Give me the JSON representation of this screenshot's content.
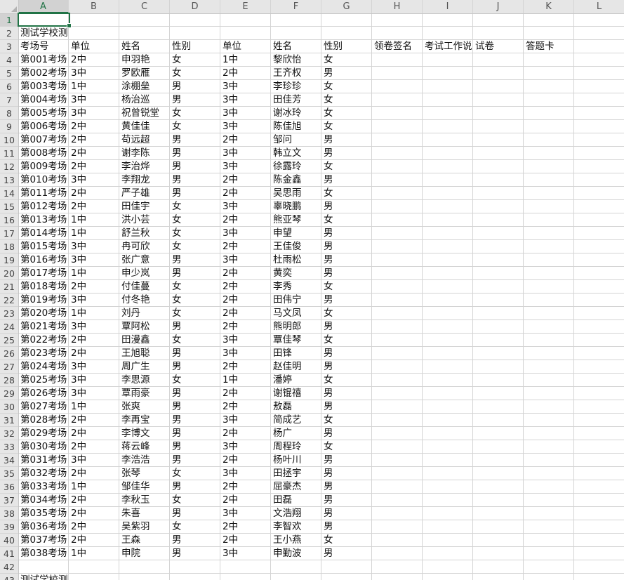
{
  "columns": [
    "A",
    "B",
    "C",
    "D",
    "E",
    "F",
    "G",
    "H",
    "I",
    "J",
    "K",
    "L"
  ],
  "active_cell": "A1",
  "colors": {
    "accent": "#217346",
    "grid": "#d4d4d4",
    "header_bg": "#e6e6e6"
  },
  "row2_title": "测试学校测",
  "header_row": {
    "A": "考场号",
    "B": "单位",
    "C": "姓名",
    "D": "性别",
    "E": "单位",
    "F": "姓名",
    "G": "性别",
    "H": "领卷签名",
    "I": "考试工作说",
    "J": "试卷",
    "K": "答题卡"
  },
  "rows": [
    [
      "第001考场",
      "2中",
      "申羽艳",
      "女",
      "1中",
      "黎欣怡",
      "女"
    ],
    [
      "第002考场",
      "3中",
      "罗欧雁",
      "女",
      "2中",
      "王齐权",
      "男"
    ],
    [
      "第003考场",
      "1中",
      "涂棚垒",
      "男",
      "3中",
      "李珍珍",
      "女"
    ],
    [
      "第004考场",
      "3中",
      "杨治巡",
      "男",
      "3中",
      "田佳芳",
      "女"
    ],
    [
      "第005考场",
      "3中",
      "祝曾锐堂",
      "女",
      "3中",
      "谢冰玲",
      "女"
    ],
    [
      "第006考场",
      "2中",
      "黄佳佳",
      "女",
      "3中",
      "陈佳旭",
      "女"
    ],
    [
      "第007考场",
      "2中",
      "苟远超",
      "男",
      "2中",
      "邹问",
      "男"
    ],
    [
      "第008考场",
      "2中",
      "谢李陈",
      "男",
      "3中",
      "韩立文",
      "男"
    ],
    [
      "第009考场",
      "2中",
      "李治烨",
      "男",
      "3中",
      "徐露玲",
      "女"
    ],
    [
      "第010考场",
      "3中",
      "李翔龙",
      "男",
      "2中",
      "陈金鑫",
      "男"
    ],
    [
      "第011考场",
      "2中",
      "严子雄",
      "男",
      "2中",
      "吴思雨",
      "女"
    ],
    [
      "第012考场",
      "2中",
      "田佳宇",
      "女",
      "3中",
      "辜晓鹏",
      "男"
    ],
    [
      "第013考场",
      "1中",
      "洪小芸",
      "女",
      "2中",
      "熊亚琴",
      "女"
    ],
    [
      "第014考场",
      "1中",
      "舒兰秋",
      "女",
      "3中",
      "申望",
      "男"
    ],
    [
      "第015考场",
      "3中",
      "冉可欣",
      "女",
      "2中",
      "王佳俊",
      "男"
    ],
    [
      "第016考场",
      "3中",
      "张广意",
      "男",
      "3中",
      "杜雨松",
      "男"
    ],
    [
      "第017考场",
      "1中",
      "申少岚",
      "男",
      "2中",
      "黄奕",
      "男"
    ],
    [
      "第018考场",
      "2中",
      "付佳蔓",
      "女",
      "2中",
      "李秀",
      "女"
    ],
    [
      "第019考场",
      "3中",
      "付冬艳",
      "女",
      "2中",
      "田伟宁",
      "男"
    ],
    [
      "第020考场",
      "1中",
      "刘丹",
      "女",
      "2中",
      "马文凤",
      "女"
    ],
    [
      "第021考场",
      "3中",
      "覃阿松",
      "男",
      "2中",
      "熊明郎",
      "男"
    ],
    [
      "第022考场",
      "2中",
      "田漫鑫",
      "女",
      "3中",
      "覃佳琴",
      "女"
    ],
    [
      "第023考场",
      "2中",
      "王旭聪",
      "男",
      "3中",
      "田锋",
      "男"
    ],
    [
      "第024考场",
      "3中",
      "周广生",
      "男",
      "2中",
      "赵佳明",
      "男"
    ],
    [
      "第025考场",
      "3中",
      "李思源",
      "女",
      "1中",
      "潘婷",
      "女"
    ],
    [
      "第026考场",
      "3中",
      "覃雨豪",
      "男",
      "2中",
      "谢锟禧",
      "男"
    ],
    [
      "第027考场",
      "1中",
      "张爽",
      "男",
      "2中",
      "敖磊",
      "男"
    ],
    [
      "第028考场",
      "2中",
      "李再宝",
      "男",
      "3中",
      "简成艺",
      "女"
    ],
    [
      "第029考场",
      "2中",
      "李博文",
      "男",
      "2中",
      "杨广",
      "男"
    ],
    [
      "第030考场",
      "2中",
      "蒋云峰",
      "男",
      "3中",
      "周程玲",
      "女"
    ],
    [
      "第031考场",
      "3中",
      "李浩浩",
      "男",
      "2中",
      "杨叶川",
      "男"
    ],
    [
      "第032考场",
      "2中",
      "张琴",
      "女",
      "3中",
      "田拯宇",
      "男"
    ],
    [
      "第033考场",
      "1中",
      "邹佳华",
      "男",
      "2中",
      "屈豪杰",
      "男"
    ],
    [
      "第034考场",
      "2中",
      "李秋玉",
      "女",
      "2中",
      "田磊",
      "男"
    ],
    [
      "第035考场",
      "2中",
      "朱喜",
      "男",
      "3中",
      "文浩翔",
      "男"
    ],
    [
      "第036考场",
      "2中",
      "吴紫羽",
      "女",
      "2中",
      "李智欢",
      "男"
    ],
    [
      "第037考场",
      "2中",
      "王森",
      "男",
      "2中",
      "王小燕",
      "女"
    ],
    [
      "第038考场",
      "1中",
      "申院",
      "男",
      "3中",
      "申勤波",
      "男"
    ]
  ],
  "row43_title": "测试学校测"
}
